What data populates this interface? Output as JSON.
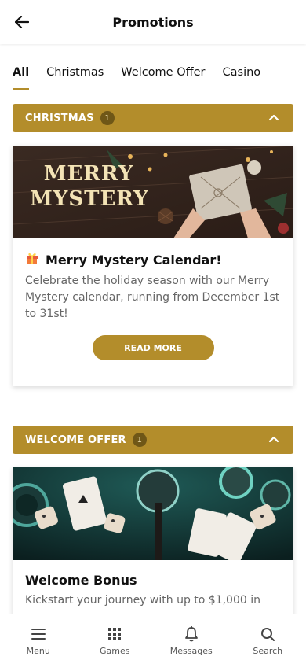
{
  "header": {
    "title": "Promotions"
  },
  "tabs": [
    {
      "label": "All",
      "active": true
    },
    {
      "label": "Christmas",
      "active": false
    },
    {
      "label": "Welcome Offer",
      "active": false
    },
    {
      "label": "Casino",
      "active": false
    }
  ],
  "sections": [
    {
      "title": "CHRISTMAS",
      "count": "1",
      "card": {
        "banner_text_1": "MERRY",
        "banner_text_2": "MYSTERY",
        "title": "Merry Mystery Calendar!",
        "description": "Celebrate the holiday season with our Merry Mystery calendar, running from December 1st to 31st!",
        "button_label": "READ MORE"
      }
    },
    {
      "title": "WELCOME OFFER",
      "count": "1",
      "card": {
        "title": "Welcome Bonus",
        "description": "Kickstart your journey with up to $1,000 in"
      }
    }
  ],
  "bottom_nav": [
    {
      "label": "Menu",
      "icon": "menu-icon"
    },
    {
      "label": "Games",
      "icon": "grid-icon"
    },
    {
      "label": "Messages",
      "icon": "bell-icon"
    },
    {
      "label": "Search",
      "icon": "search-icon"
    }
  ],
  "colors": {
    "accent": "#b38d2b",
    "badge": "#6f5717"
  }
}
